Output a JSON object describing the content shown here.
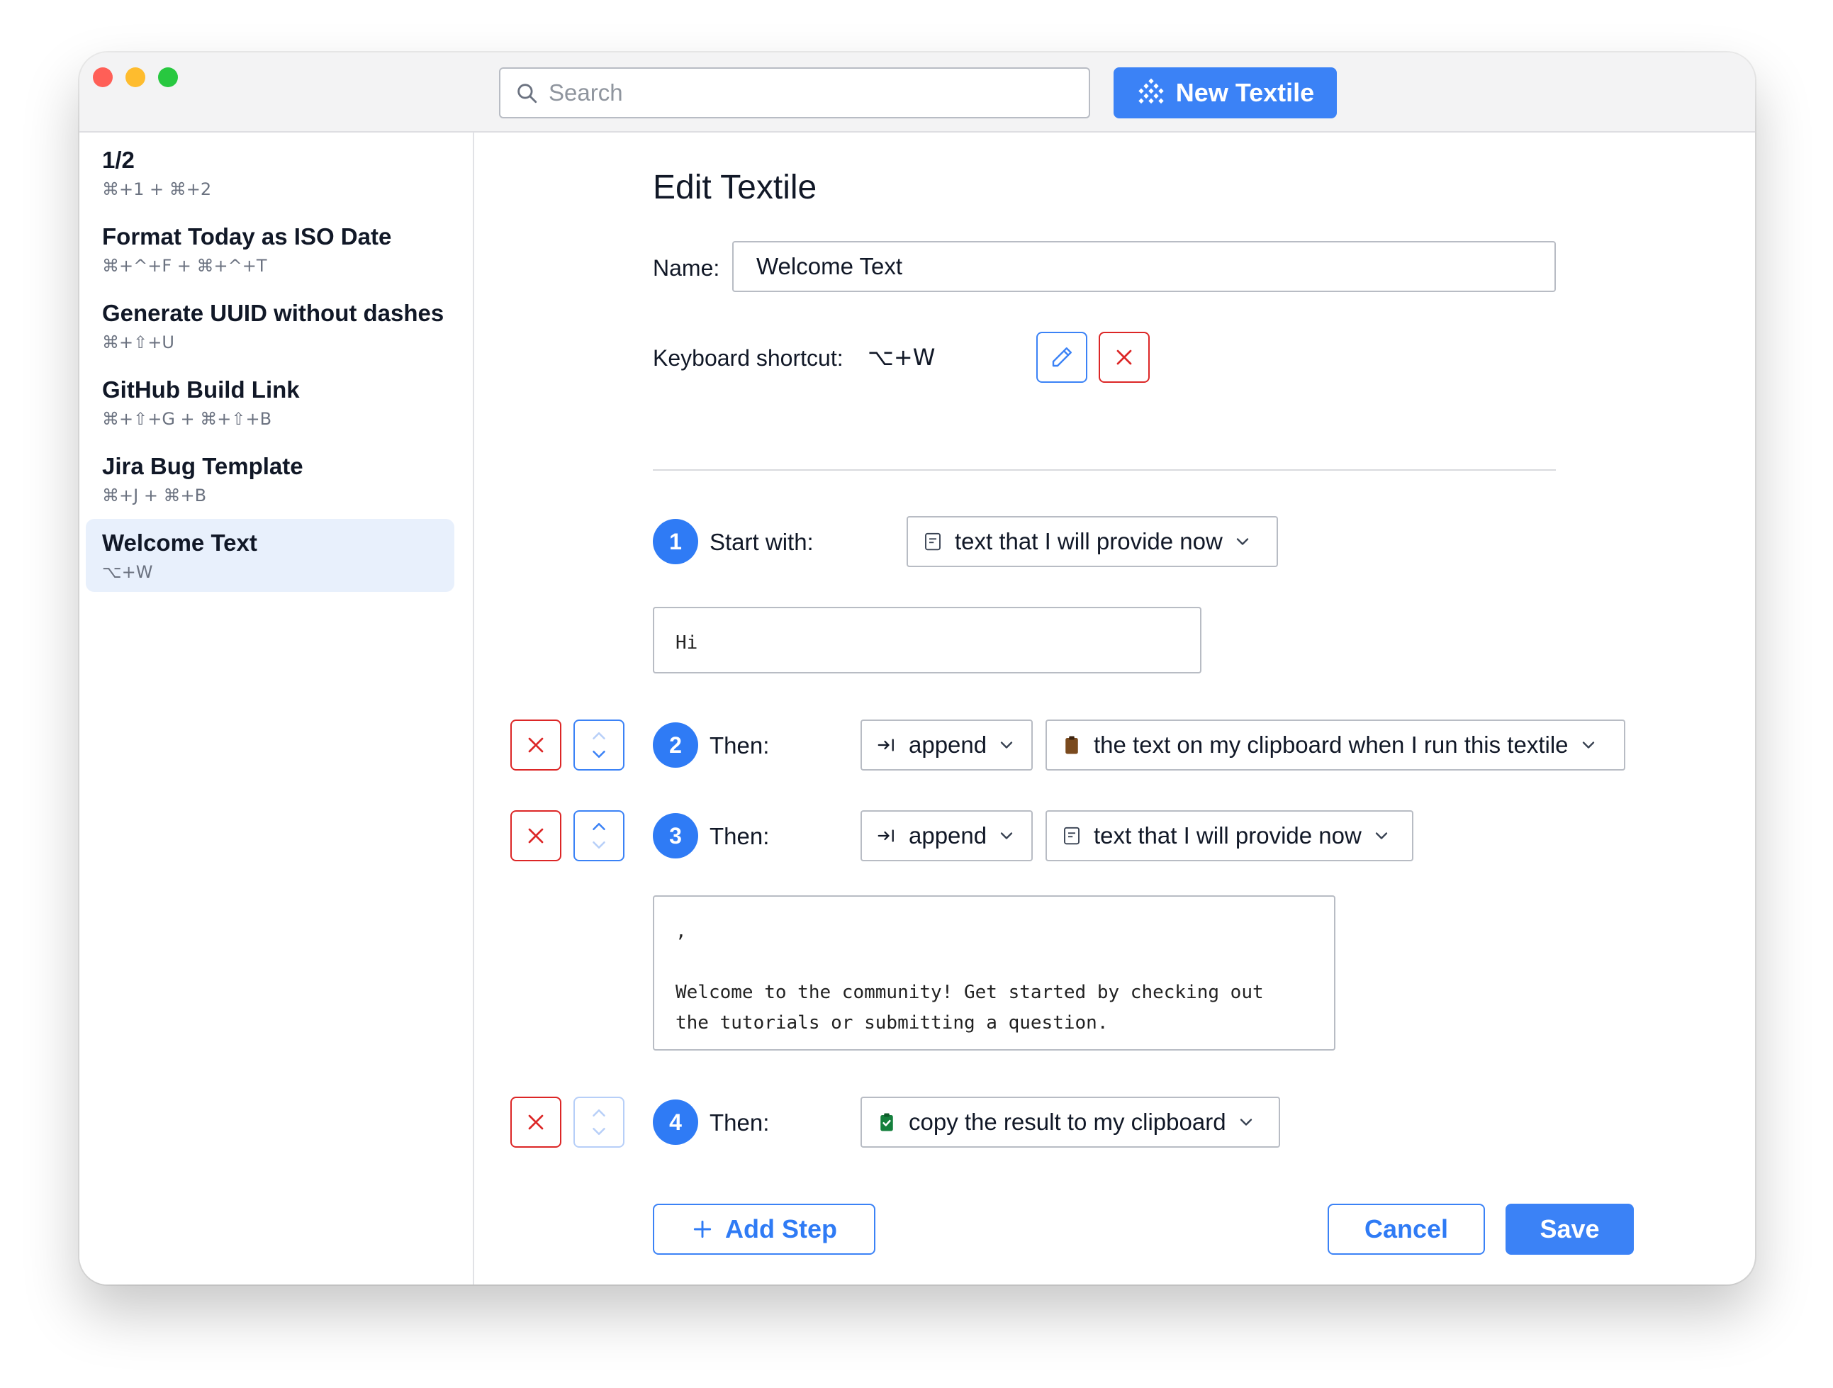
{
  "search": {
    "placeholder": "Search"
  },
  "toolbar": {
    "new_label": "New Textile"
  },
  "sidebar": {
    "items": [
      {
        "title": "1/2",
        "shortcut": "⌘+1  +  ⌘+2"
      },
      {
        "title": "Format Today as ISO Date",
        "shortcut": "⌘+^+F  +  ⌘+^+T"
      },
      {
        "title": "Generate UUID without dashes",
        "shortcut": "⌘+⇧+U"
      },
      {
        "title": "GitHub Build Link",
        "shortcut": "⌘+⇧+G  +  ⌘+⇧+B"
      },
      {
        "title": "Jira Bug Template",
        "shortcut": "⌘+J  +  ⌘+B"
      },
      {
        "title": "Welcome Text",
        "shortcut": "⌥+W",
        "selected": true
      }
    ]
  },
  "editor": {
    "heading": "Edit Textile",
    "name_label": "Name:",
    "name_value": "Welcome Text",
    "shortcut_label": "Keyboard shortcut:",
    "shortcut_value": "⌥+W"
  },
  "steps": [
    {
      "number": "1",
      "label": "Start with:",
      "source": "text that I will provide now",
      "source_icon": "text-doc-icon",
      "text": "Hi"
    },
    {
      "number": "2",
      "label": "Then:",
      "action": "append",
      "action_icon": "append-arrow-icon",
      "source": "the text on my clipboard when I run this textile",
      "source_icon": "clipboard-icon"
    },
    {
      "number": "3",
      "label": "Then:",
      "action": "append",
      "action_icon": "append-arrow-icon",
      "source": "text that I will provide now",
      "source_icon": "text-doc-icon",
      "text": ",\n\nWelcome to the community! Get started by checking out\nthe tutorials or submitting a question."
    },
    {
      "number": "4",
      "label": "Then:",
      "action": "copy the result to my clipboard",
      "action_icon": "clipboard-check-icon"
    }
  ],
  "footer": {
    "add_step": "Add Step",
    "cancel": "Cancel",
    "save": "Save"
  },
  "colors": {
    "accent": "#3b82f6",
    "danger": "#dc2626",
    "selected_bg": "#e8f0fc",
    "clipboard_brown": "#7a4a1e",
    "clipboard_green": "#15803d"
  }
}
